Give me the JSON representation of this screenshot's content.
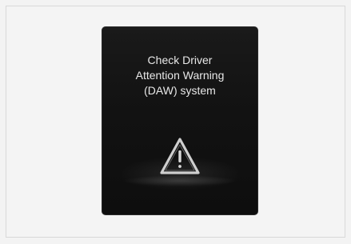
{
  "display": {
    "message_lines": [
      "Check Driver",
      "Attention Warning",
      "(DAW) system"
    ],
    "icon": "warning-triangle-icon",
    "background_color": "#141414",
    "text_color": "#e8e8e8"
  }
}
